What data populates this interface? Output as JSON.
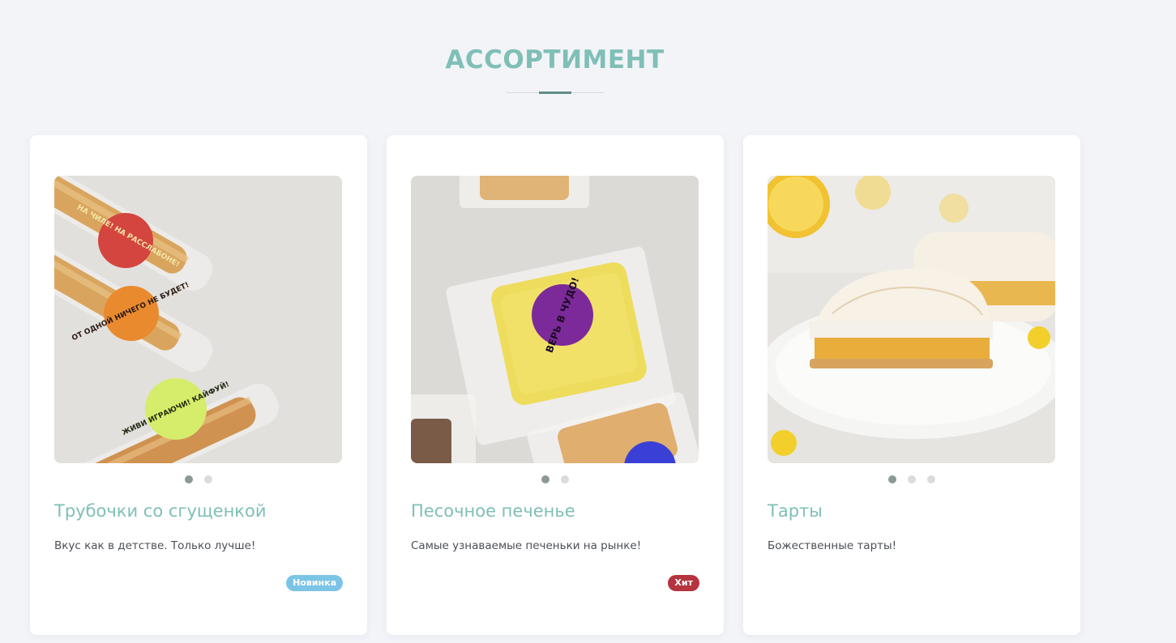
{
  "section": {
    "title": "АССОРТИМЕНТ"
  },
  "products": [
    {
      "title": "Трубочки со сгущенкой",
      "description": "Вкус как в детстве. Только лучше!",
      "badge": "Новинка",
      "badge_color": "#7cc4e6",
      "image_count": 2,
      "active_image": 1,
      "stickers": [
        "НА ЧИЛЕ! НА РАССЛАБОНЕ!",
        "ОТ ОДНОЙ НИЧЕГО НЕ БУДЕТ!",
        "ЖИВИ ИГРАЮЧИ! КАЙФУЙ!"
      ]
    },
    {
      "title": "Песочное печенье",
      "description": "Самые узнаваемые печеньки на рынке!",
      "badge": "Хит",
      "badge_color": "#b5343f",
      "image_count": 2,
      "active_image": 1,
      "stickers": [
        "ВЕРЬ В ЧУДО!"
      ]
    },
    {
      "title": "Тарты",
      "description": "Божественные тарты!",
      "image_count": 3,
      "active_image": 1
    }
  ],
  "colors": {
    "accent": "#7fbfb7",
    "accent_dark": "#5f8e89",
    "background": "#f3f4f8"
  }
}
